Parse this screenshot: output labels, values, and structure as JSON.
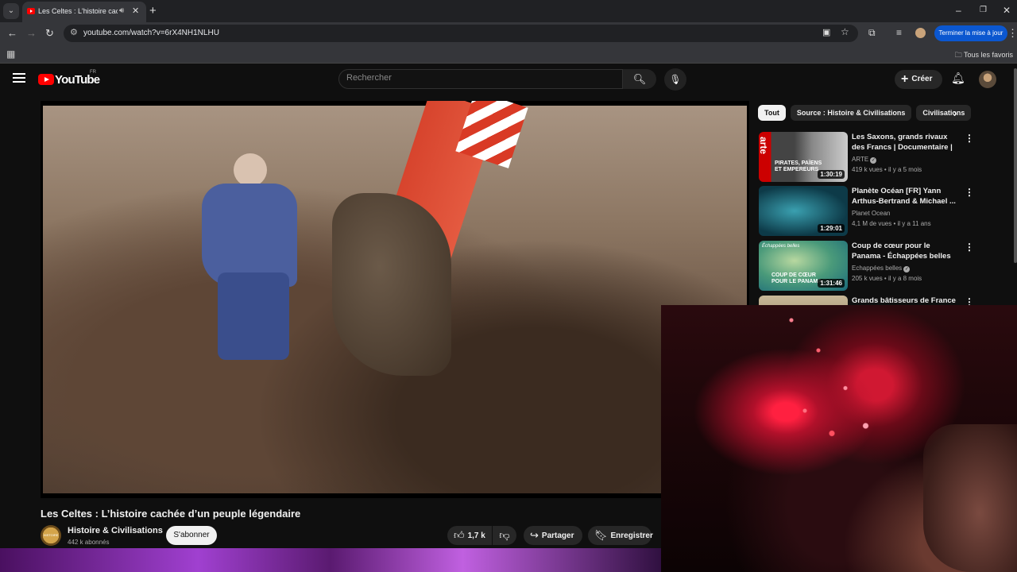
{
  "browser": {
    "tab_title": "Les Celtes : L'histoire cachée d'un peuple légendaire - YouTube",
    "url": "youtube.com/watch?v=6rX4NH1NLHU",
    "update_label": "Terminer la mise à jour",
    "bookmarks_label": "Tous les favoris"
  },
  "header": {
    "logo_text": "YouTube",
    "country_code": "FR",
    "search_placeholder": "Rechercher",
    "create_label": "Créer"
  },
  "video": {
    "title": "Les Celtes : L’histoire cachée d’un peuple légendaire",
    "channel": "Histoire & Civilisations",
    "channel_avatar_text": "HISTOIRE",
    "subscribers": "442 k abonnés",
    "subscribe_label": "S'abonner",
    "likes": "1,7 k",
    "share_label": "Partager",
    "save_label": "Enregistrer"
  },
  "chips": [
    {
      "label": "Tout",
      "active": true
    },
    {
      "label": "Source : Histoire & Civilisations",
      "active": false
    },
    {
      "label": "Civilisations",
      "active": false
    }
  ],
  "recommendations": [
    {
      "title": "Les Saxons, grands rivaux des Francs | Documentaire | ARTE",
      "channel": "ARTE",
      "meta": "419 k vues • il y a 5 mois",
      "duration": "1:30:19",
      "thumb_text": "PIRATES, PAÏENS ET EMPEREURS",
      "thumb_brand": "arte"
    },
    {
      "title": "Planète Océan [FR] Yann Arthus-Bertrand & Michael ...",
      "channel": "Planet Ocean",
      "meta": "4,1 M de vues • il y a 11 ans",
      "duration": "1:29:01"
    },
    {
      "title": "Coup de cœur pour le Panama - Échappées belles",
      "channel": "Echappées belles",
      "meta": "205 k vues • il y a 8 mois",
      "duration": "1:31:46",
      "thumb_text": "COUP DE CŒUR POUR LE PANAMA",
      "thumb_brand": "Échappées belles"
    },
    {
      "title": "Grands bâtisseurs de France :",
      "channel": "",
      "meta": "",
      "duration": ""
    }
  ],
  "colors": {
    "brand_red": "#ff0000",
    "update_blue": "#0b57d0",
    "background": "#0f0f0f"
  }
}
